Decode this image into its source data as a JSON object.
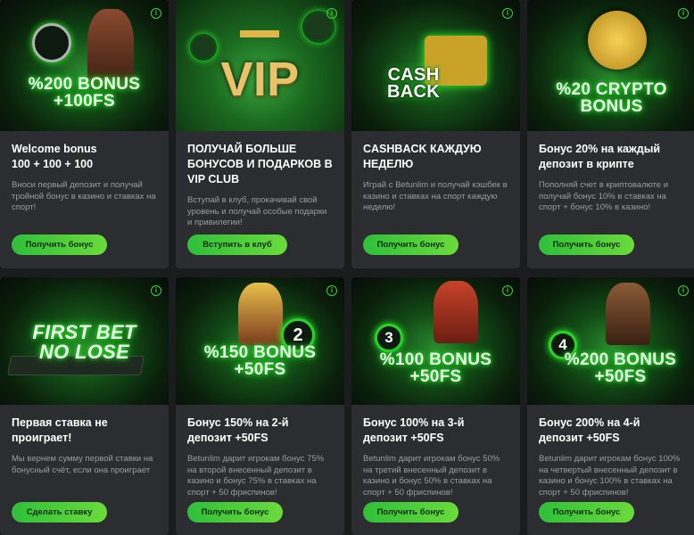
{
  "cards": [
    {
      "banner_text": "%200 BONUS\n+100FS",
      "title": "Welcome bonus\n100 + 100 + 100",
      "desc": "Вноси первый депозит и получай тройной бонус в казино и ставках на спорт!",
      "button": "Получить бонус"
    },
    {
      "banner_text": "VIP",
      "title": "ПОЛУЧАЙ БОЛЬШЕ БОНУСОВ И ПОДАРКОВ В VIP CLUB",
      "desc": "Вступай в клуб, прокачивай свой уровень и получай особые подарки и привилегии!",
      "button": "Вступить в клуб"
    },
    {
      "banner_text": "CASH\nBACK",
      "title": "CASHBACK КАЖДУЮ НЕДЕЛЮ",
      "desc": "Играй с Betunlim и получай кэшбек в казино и ставках на спорт каждую неделю!",
      "button": "Получить бонус"
    },
    {
      "banner_text": "%20 CRYPTO\nBONUS",
      "title": "Бонус 20% на каждый депозит в крипте",
      "desc": "Пополняй счет в криптовалюте и получай бонус 10% в ставках на спорт + бонус 10% в казино!",
      "button": "Получить бонус"
    },
    {
      "banner_text": "FIRST BET\nNO LOSE",
      "title": "Первая ставка не проиграет!",
      "desc": "Мы вернем сумму первой ставки на бонусный счёт, если она проиграет",
      "button": "Сделать ставку"
    },
    {
      "banner_text": "%150 BONUS\n+50FS",
      "badge": "2",
      "title": "Бонус 150% на 2-й депозит +50FS",
      "desc": "Betunlim дарит игрокам бонус 75% на второй внесенный депозит в казино и бонус 75% в ставках на спорт + 50 фриспинов!",
      "button": "Получить бонус"
    },
    {
      "banner_text": "%100 BONUS\n+50FS",
      "badge": "3",
      "title": "Бонус 100% на 3-й депозит +50FS",
      "desc": "Betunlim дарит игрокам бонус 50% на третий внесенный депозит в казино и бонус 50% в ставках на спорт + 50 фриспинов!",
      "button": "Получить бонус"
    },
    {
      "banner_text": "%200 BONUS\n+50FS",
      "badge": "4",
      "title": "Бонус 200% на 4-й депозит +50FS",
      "desc": "Betunlim дарит игрокам бонус 100% на четвертый внесенный депозит в казино и бонус 100% в ставках на спорт + 50 фриспинов!",
      "button": "Получить бонус"
    }
  ],
  "info_glyph": "i",
  "colors": {
    "accent": "#3fd13f",
    "card_bg": "#2b2d30",
    "page_bg": "#1a1c1e"
  }
}
